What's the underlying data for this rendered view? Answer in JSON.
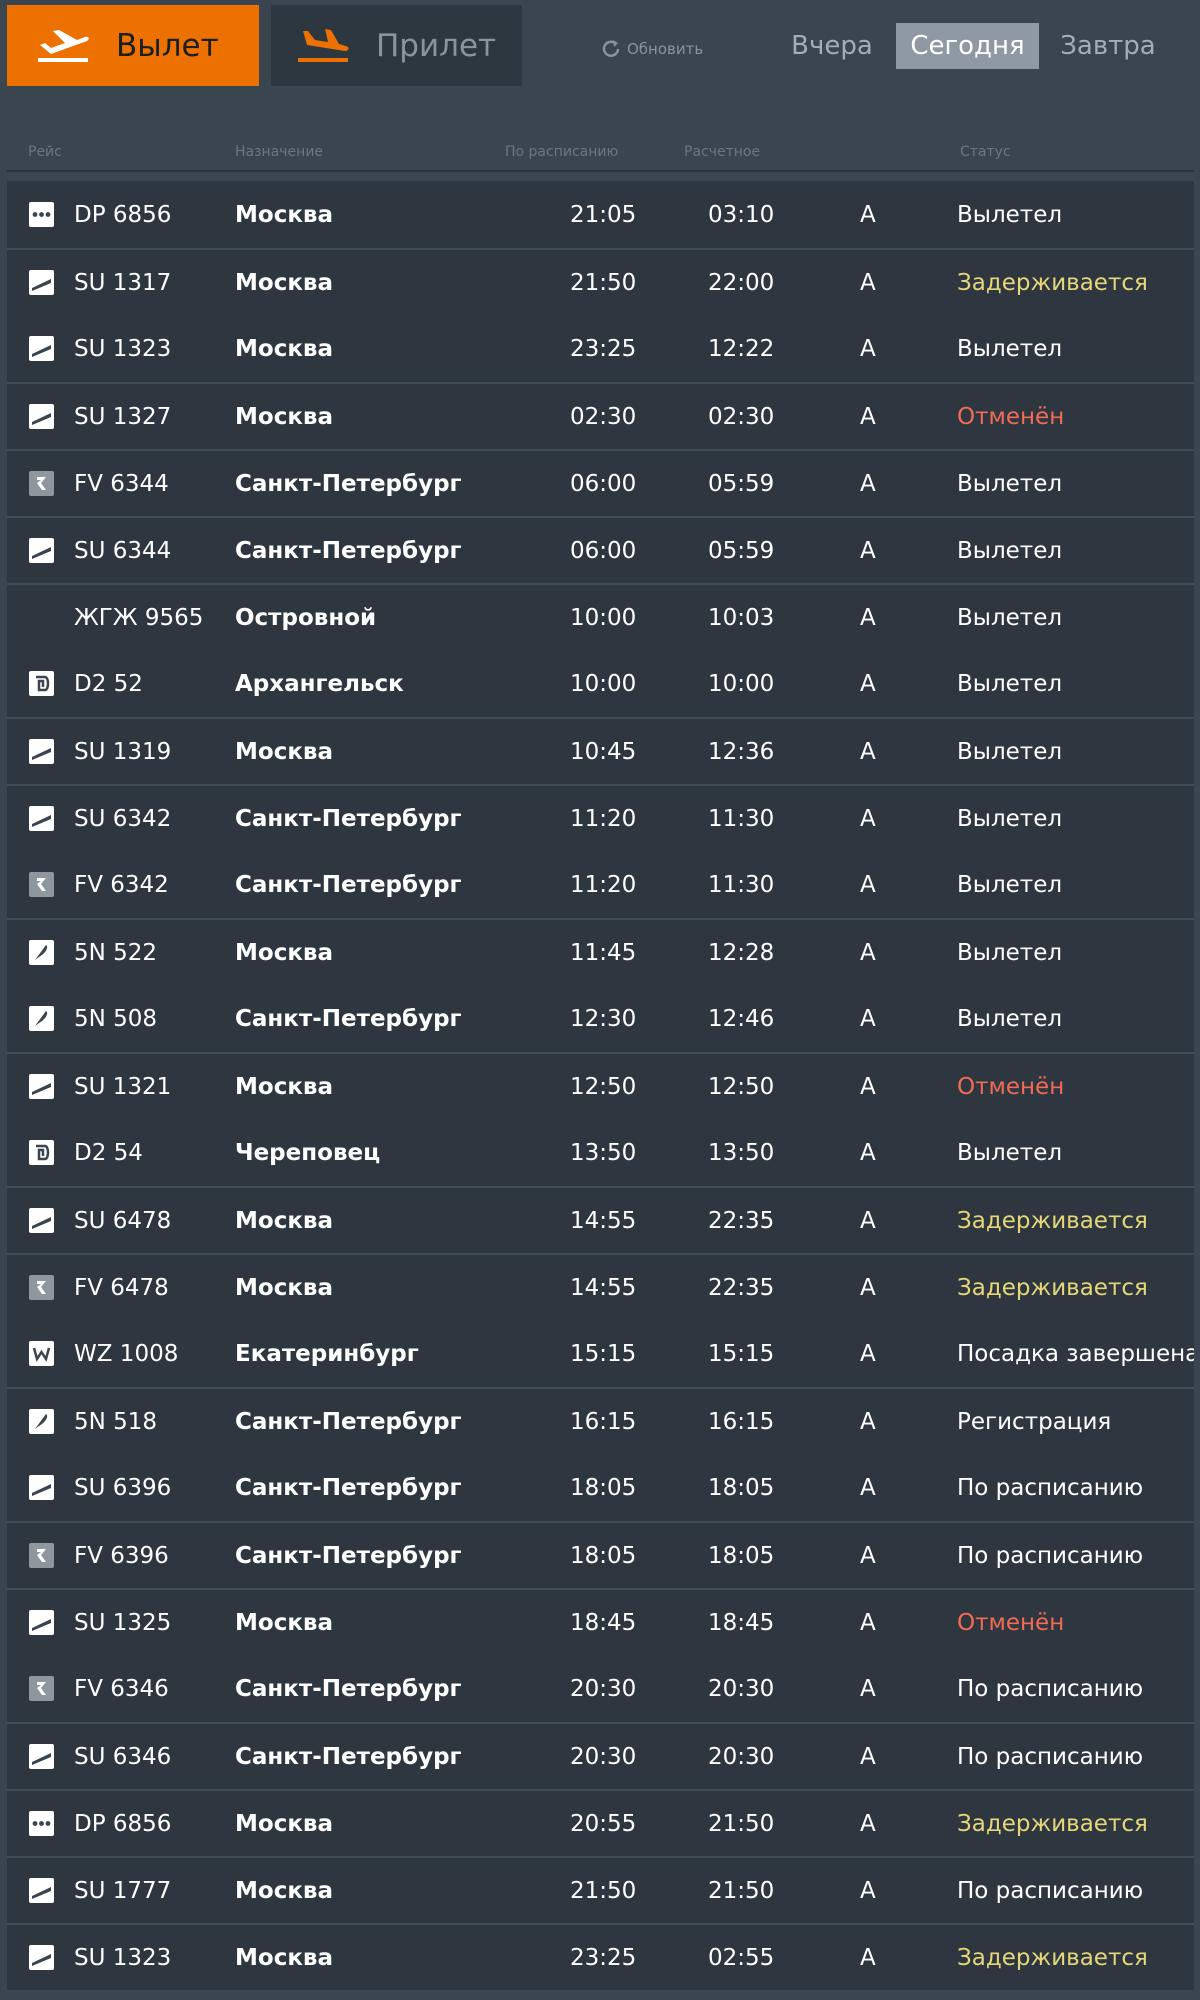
{
  "tabs": {
    "departure": "Вылет",
    "arrival": "Прилет"
  },
  "refresh_label": "Обновить",
  "days": {
    "yesterday": "Вчера",
    "today": "Сегодня",
    "tomorrow": "Завтра"
  },
  "columns": {
    "flight": "Рейс",
    "destination": "Назначение",
    "scheduled": "По расписанию",
    "estimated": "Расчетное",
    "status": "Статус"
  },
  "colors": {
    "accent": "#ec7100",
    "status_delayed": "#e6d67a",
    "status_cancelled": "#f26b55",
    "status_normal": "#ffffff"
  },
  "flights": [
    {
      "airline_icon": "dots-logo",
      "flight": "DP 6856",
      "destination": "Москва",
      "scheduled": "21:05",
      "estimated": "03:10",
      "gate": "A",
      "status": "Вылетел",
      "kind": "normal",
      "sep": false
    },
    {
      "airline_icon": "wing-logo",
      "flight": "SU 1317",
      "destination": "Москва",
      "scheduled": "21:50",
      "estimated": "22:00",
      "gate": "A",
      "status": "Задерживается",
      "kind": "delay",
      "sep": true
    },
    {
      "airline_icon": "wing-logo",
      "flight": "SU 1323",
      "destination": "Москва",
      "scheduled": "23:25",
      "estimated": "12:22",
      "gate": "A",
      "status": "Вылетел",
      "kind": "normal",
      "sep": false
    },
    {
      "airline_icon": "wing-logo",
      "flight": "SU 1327",
      "destination": "Москва",
      "scheduled": "02:30",
      "estimated": "02:30",
      "gate": "A",
      "status": "Отменён",
      "kind": "cancel",
      "sep": true
    },
    {
      "airline_icon": "r-logo",
      "flight": "FV 6344",
      "destination": "Санкт-Петербург",
      "scheduled": "06:00",
      "estimated": "05:59",
      "gate": "A",
      "status": "Вылетел",
      "kind": "normal",
      "sep": true
    },
    {
      "airline_icon": "wing-logo",
      "flight": "SU 6344",
      "destination": "Санкт-Петербург",
      "scheduled": "06:00",
      "estimated": "05:59",
      "gate": "A",
      "status": "Вылетел",
      "kind": "normal",
      "sep": true
    },
    {
      "airline_icon": "none",
      "flight": "ЖГЖ 9565",
      "destination": "Островной",
      "scheduled": "10:00",
      "estimated": "10:03",
      "gate": "A",
      "status": "Вылетел",
      "kind": "normal",
      "sep": true
    },
    {
      "airline_icon": "d2-logo",
      "flight": "D2 52",
      "destination": "Архангельск",
      "scheduled": "10:00",
      "estimated": "10:00",
      "gate": "A",
      "status": "Вылетел",
      "kind": "normal",
      "sep": false
    },
    {
      "airline_icon": "wing-logo",
      "flight": "SU 1319",
      "destination": "Москва",
      "scheduled": "10:45",
      "estimated": "12:36",
      "gate": "A",
      "status": "Вылетел",
      "kind": "normal",
      "sep": true
    },
    {
      "airline_icon": "wing-logo",
      "flight": "SU 6342",
      "destination": "Санкт-Петербург",
      "scheduled": "11:20",
      "estimated": "11:30",
      "gate": "A",
      "status": "Вылетел",
      "kind": "normal",
      "sep": true
    },
    {
      "airline_icon": "r-logo",
      "flight": "FV 6342",
      "destination": "Санкт-Петербург",
      "scheduled": "11:20",
      "estimated": "11:30",
      "gate": "A",
      "status": "Вылетел",
      "kind": "normal",
      "sep": false
    },
    {
      "airline_icon": "feather-logo",
      "flight": "5N 522",
      "destination": "Москва",
      "scheduled": "11:45",
      "estimated": "12:28",
      "gate": "A",
      "status": "Вылетел",
      "kind": "normal",
      "sep": true
    },
    {
      "airline_icon": "feather-logo",
      "flight": "5N 508",
      "destination": "Санкт-Петербург",
      "scheduled": "12:30",
      "estimated": "12:46",
      "gate": "A",
      "status": "Вылетел",
      "kind": "normal",
      "sep": false
    },
    {
      "airline_icon": "wing-logo",
      "flight": "SU 1321",
      "destination": "Москва",
      "scheduled": "12:50",
      "estimated": "12:50",
      "gate": "A",
      "status": "Отменён",
      "kind": "cancel",
      "sep": true
    },
    {
      "airline_icon": "d2-logo",
      "flight": "D2 54",
      "destination": "Череповец",
      "scheduled": "13:50",
      "estimated": "13:50",
      "gate": "A",
      "status": "Вылетел",
      "kind": "normal",
      "sep": false
    },
    {
      "airline_icon": "wing-logo",
      "flight": "SU 6478",
      "destination": "Москва",
      "scheduled": "14:55",
      "estimated": "22:35",
      "gate": "A",
      "status": "Задерживается",
      "kind": "delay",
      "sep": true
    },
    {
      "airline_icon": "r-logo",
      "flight": "FV 6478",
      "destination": "Москва",
      "scheduled": "14:55",
      "estimated": "22:35",
      "gate": "A",
      "status": "Задерживается",
      "kind": "delay",
      "sep": true
    },
    {
      "airline_icon": "w-logo",
      "flight": "WZ 1008",
      "destination": "Екатеринбург",
      "scheduled": "15:15",
      "estimated": "15:15",
      "gate": "A",
      "status": "Посадка завершена",
      "kind": "normal",
      "sep": false
    },
    {
      "airline_icon": "feather-logo",
      "flight": "5N 518",
      "destination": "Санкт-Петербург",
      "scheduled": "16:15",
      "estimated": "16:15",
      "gate": "A",
      "status": "Регистрация",
      "kind": "normal",
      "sep": true
    },
    {
      "airline_icon": "wing-logo",
      "flight": "SU 6396",
      "destination": "Санкт-Петербург",
      "scheduled": "18:05",
      "estimated": "18:05",
      "gate": "A",
      "status": "По расписанию",
      "kind": "normal",
      "sep": false
    },
    {
      "airline_icon": "r-logo",
      "flight": "FV 6396",
      "destination": "Санкт-Петербург",
      "scheduled": "18:05",
      "estimated": "18:05",
      "gate": "A",
      "status": "По расписанию",
      "kind": "normal",
      "sep": true
    },
    {
      "airline_icon": "wing-logo",
      "flight": "SU 1325",
      "destination": "Москва",
      "scheduled": "18:45",
      "estimated": "18:45",
      "gate": "A",
      "status": "Отменён",
      "kind": "cancel",
      "sep": true
    },
    {
      "airline_icon": "r-logo",
      "flight": "FV 6346",
      "destination": "Санкт-Петербург",
      "scheduled": "20:30",
      "estimated": "20:30",
      "gate": "A",
      "status": "По расписанию",
      "kind": "normal",
      "sep": false
    },
    {
      "airline_icon": "wing-logo",
      "flight": "SU 6346",
      "destination": "Санкт-Петербург",
      "scheduled": "20:30",
      "estimated": "20:30",
      "gate": "A",
      "status": "По расписанию",
      "kind": "normal",
      "sep": true
    },
    {
      "airline_icon": "dots-logo",
      "flight": "DP 6856",
      "destination": "Москва",
      "scheduled": "20:55",
      "estimated": "21:50",
      "gate": "A",
      "status": "Задерживается",
      "kind": "delay",
      "sep": true
    },
    {
      "airline_icon": "wing-logo",
      "flight": "SU 1777",
      "destination": "Москва",
      "scheduled": "21:50",
      "estimated": "21:50",
      "gate": "A",
      "status": "По расписанию",
      "kind": "normal",
      "sep": true
    },
    {
      "airline_icon": "wing-logo",
      "flight": "SU 1323",
      "destination": "Москва",
      "scheduled": "23:25",
      "estimated": "02:55",
      "gate": "A",
      "status": "Задерживается",
      "kind": "delay",
      "sep": true
    }
  ]
}
